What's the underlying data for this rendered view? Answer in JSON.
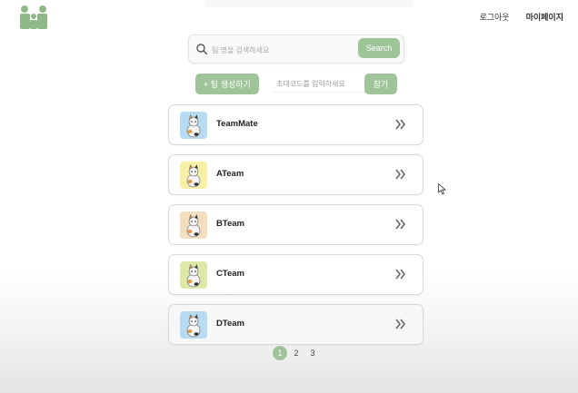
{
  "header": {
    "logo_icon": "family-logo-icon",
    "logout_label": "로그아웃",
    "mypage_label": "마이페이지"
  },
  "search": {
    "placeholder": "팀 명을 검색하세요",
    "button_label": "Search",
    "icon": "search-icon"
  },
  "actions": {
    "create_label": "+ 팀 생성하기",
    "invite_placeholder": "초대코드를 입력하세요",
    "join_label": "참가"
  },
  "teams": [
    {
      "name": "TeamMate",
      "avatar_bg": "#b7dcf2"
    },
    {
      "name": "ATeam",
      "avatar_bg": "#f7f1a8"
    },
    {
      "name": "BTeam",
      "avatar_bg": "#f3dfc0"
    },
    {
      "name": "CTeam",
      "avatar_bg": "#dfe8a8"
    },
    {
      "name": "DTeam",
      "avatar_bg": "#b7dcf2"
    }
  ],
  "pagination": {
    "pages": [
      "1",
      "2",
      "3"
    ],
    "current": "1"
  },
  "colors": {
    "accent": "#9fc49a",
    "logo": "#8fb987"
  }
}
